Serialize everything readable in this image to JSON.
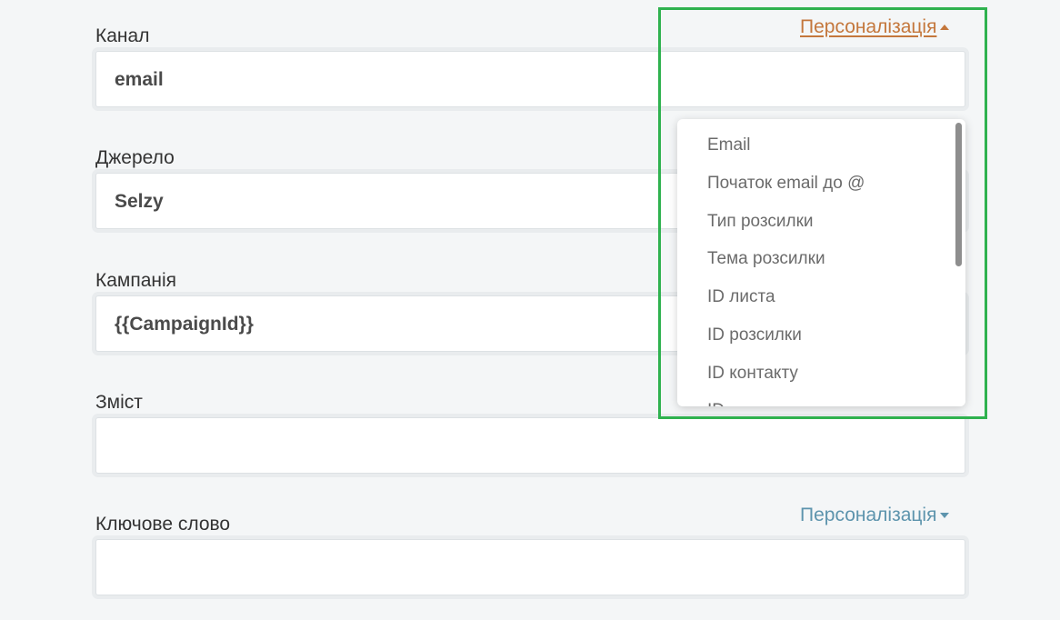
{
  "form": {
    "fields": [
      {
        "label": "Канал",
        "value": "email",
        "personalization_label": "Персоналізація"
      },
      {
        "label": "Джерело",
        "value": "Selzy",
        "personalization_label": ""
      },
      {
        "label": "Кампанія",
        "value": "{{CampaignId}}",
        "personalization_label": ""
      },
      {
        "label": "Зміст",
        "value": "",
        "personalization_label": ""
      },
      {
        "label": "Ключове слово",
        "value": "",
        "personalization_label": "Персоналізація"
      }
    ]
  },
  "dropdown": {
    "items": [
      "Email",
      "Початок email до @",
      "Тип розсилки",
      "Тема розсилки",
      "ID листа",
      "ID розсилки",
      "ID контакту",
      "ID"
    ]
  },
  "colors": {
    "active_link": "#c4773c",
    "link": "#5d94ad",
    "highlight": "#2fb24f"
  }
}
